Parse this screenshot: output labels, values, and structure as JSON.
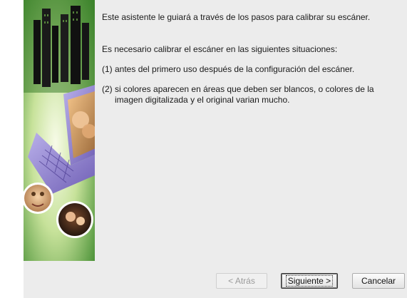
{
  "content": {
    "intro": "Este asistente le guiará a través de los pasos para calibrar su escáner.",
    "subtitle": "Es necesario calibrar el escáner en las siguientes situaciones:",
    "items": [
      {
        "number": "(1)",
        "text": "antes del primero uso después de la configuración del escáner."
      },
      {
        "number": "(2)",
        "text": "si colores aparecen en áreas que deben ser blancos, o colores de la imagen digitalizada y el original varian mucho."
      }
    ]
  },
  "buttons": {
    "back_label": "< Atrás",
    "next_label": "Siguiente >",
    "cancel_label": "Cancelar"
  },
  "colors": {
    "window_bg": "#ececec",
    "sidebar_green": "#4f9a3c",
    "laptop_purple": "#8a78c8"
  }
}
